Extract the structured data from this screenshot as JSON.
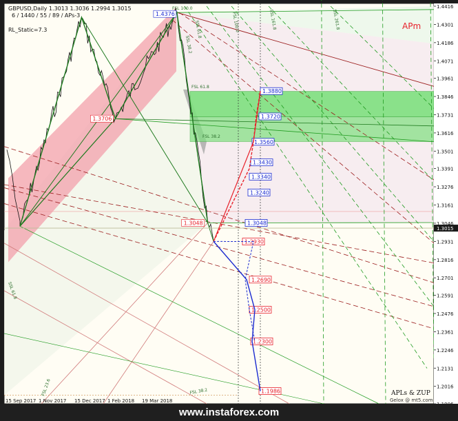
{
  "header": {
    "symbol_line": "GBPUSD,Daily  1.3013 1.3036 1.2994 1.3015",
    "params_line": "6 / 1440 / 55 / 89 / APs-3",
    "indicator": "RL_Static=7.3"
  },
  "tag": "APm",
  "signature": [
    "APLs & ZUP",
    "Gelox @ mt5.com"
  ],
  "watermark": "www.instaforex.com",
  "colors": {
    "bull": "#e8202a",
    "bear": "#1a2ad0",
    "green": "#1e9a1e",
    "maroon": "#9b1c1c",
    "band_green": "#7fe07f",
    "band_pink": "#f3a0ac",
    "current_price": "#1a2ad0"
  },
  "chart_data": {
    "type": "line",
    "title": "GBPUSD,Daily",
    "last": {
      "open": 1.3013,
      "high": 1.3036,
      "low": 1.2994,
      "close": 1.3015
    },
    "current_price": 1.3015,
    "xlabel": "",
    "ylabel": "",
    "x_ticks": [
      "15 Sep 2017",
      "1 Nov 2017",
      "15 Dec 2017",
      "1 Feb 2018",
      "19 Mar 2018"
    ],
    "y_ticks": [
      1.4416,
      1.4301,
      1.4186,
      1.4071,
      1.3961,
      1.3846,
      1.3731,
      1.3616,
      1.3501,
      1.3391,
      1.3276,
      1.3161,
      1.3046,
      1.2931,
      1.2816,
      1.2701,
      1.2591,
      1.2476,
      1.2361,
      1.2246,
      1.2131,
      1.2016,
      1.1906
    ],
    "ylim": [
      1.1906,
      1.4416
    ],
    "pivots": [
      {
        "date": "15 Sep 2017",
        "value": 1.3027
      },
      {
        "date": "8 Dec 2017",
        "value": 1.4346
      },
      {
        "date": "23 Jan 2018",
        "value": 1.3706
      },
      {
        "date": "17 Apr 2018",
        "value": 1.4376
      },
      {
        "date": "29 May 2018",
        "value": 1.3048
      },
      {
        "date": "6 Jun 2018",
        "value": 1.2931
      }
    ],
    "price_labels": {
      "high": "1.4376",
      "mid": "1.3706",
      "low": "1.3048"
    },
    "projection_up": [
      "1.3880",
      "1.3720",
      "1.3560",
      "1.3430",
      "1.3340",
      "1.3240",
      "1.3048"
    ],
    "projection_down": [
      "1.2930",
      "1.2690",
      "1.2500",
      "1.2300",
      "1.1986"
    ],
    "zones": [
      {
        "name": "FSL 61.8",
        "from": 1.3718,
        "to": 1.3878
      },
      {
        "name": "FSL 38.2",
        "from": 1.3561,
        "to": 1.3718
      }
    ],
    "fan_labels": [
      "FSL 100.0",
      "SSL 61.8",
      "SSL 38.2",
      "FSL 61.8",
      "FSL 38.2",
      "FSL 100.0",
      "SSL 161.8",
      "SSL 261.8",
      "SSL 61.8",
      "FSL 23.6",
      "FSL 38.2"
    ]
  }
}
